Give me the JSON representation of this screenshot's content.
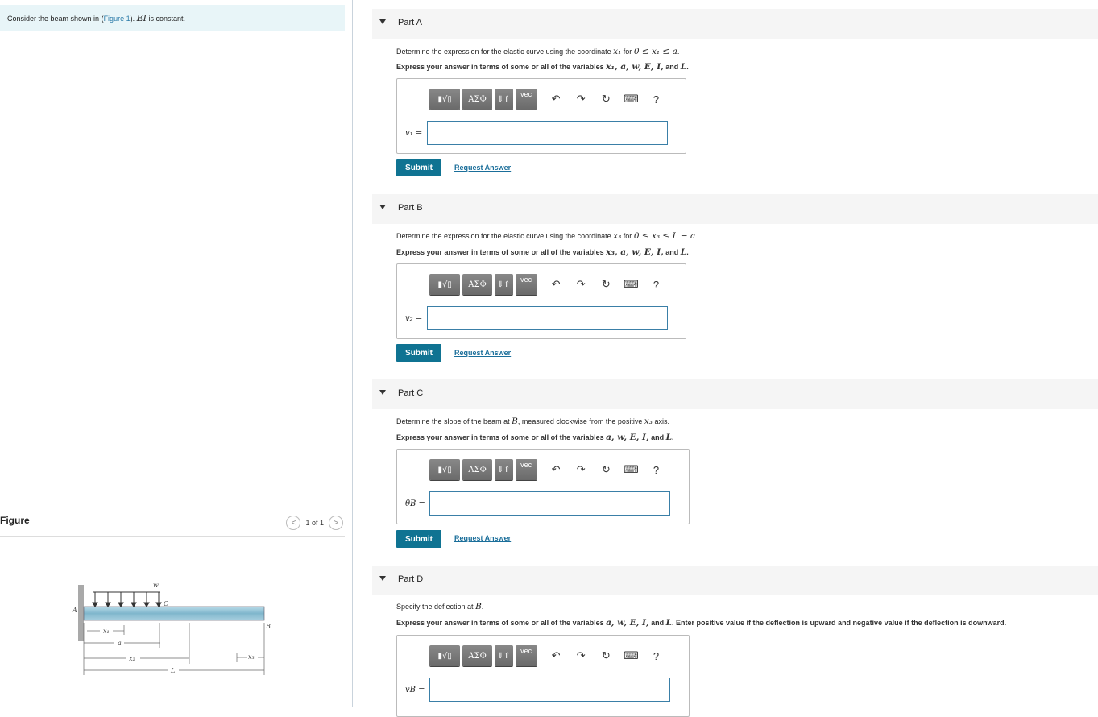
{
  "intro": {
    "before": "Consider the beam shown in (",
    "link": "Figure 1",
    "after": "). ",
    "math": "EI",
    "tail": " is constant."
  },
  "figure": {
    "title": "Figure",
    "pager": "1 of 1",
    "prev": "<",
    "next": ">",
    "labels": {
      "w": "w",
      "A": "A",
      "C": "C",
      "B": "B",
      "x1": "x₁",
      "a": "a",
      "x2": "x₂",
      "L": "L",
      "x3": "x₃"
    }
  },
  "toolbar": {
    "t1": "▮√▯",
    "t2": "ΑΣΦ",
    "t3": "⇓⇑",
    "t4": "vec",
    "undo": "↶",
    "redo": "↷",
    "reset": "↻",
    "keyboard": "⌨",
    "help": "?"
  },
  "parts": [
    {
      "title": "Part A",
      "q1": [
        "Determine the expression for the elastic curve using the coordinate ",
        "x₁",
        " for ",
        "0 ≤ x₁ ≤ a",
        "."
      ],
      "q2": [
        "Express your answer in terms of some or all of the variables ",
        "x₁, a, w, E, I,",
        " and ",
        "L",
        "."
      ],
      "label": "v₁ =",
      "submit": "Submit",
      "request": "Request Answer"
    },
    {
      "title": "Part B",
      "q1": [
        "Determine the expression for the elastic curve using the coordinate ",
        "x₃",
        " for ",
        "0 ≤ x₃ ≤ L − a",
        "."
      ],
      "q2": [
        "Express your answer in terms of some or all of the variables ",
        "x₃, a, w, E, I,",
        " and ",
        "L",
        "."
      ],
      "label": "v₂ =",
      "submit": "Submit",
      "request": "Request Answer"
    },
    {
      "title": "Part C",
      "q1": [
        "Determine the slope of the beam at ",
        "B",
        ", measured clockwise from the positive ",
        "x₃",
        " axis."
      ],
      "q2": [
        "Express your answer in terms of some or all of the variables ",
        "a, w, E, I,",
        " and ",
        "L",
        "."
      ],
      "label": "θB =",
      "submit": "Submit",
      "request": "Request Answer"
    },
    {
      "title": "Part D",
      "q1": [
        "Specify the deflection at ",
        "B",
        "."
      ],
      "q2": [
        "Express your answer in terms of some or all of the variables ",
        "a, w, E, I,",
        " and ",
        "L",
        ". Enter positive value if the deflection is upward and negative value if the deflection is downward."
      ],
      "label": "vB ="
    }
  ]
}
